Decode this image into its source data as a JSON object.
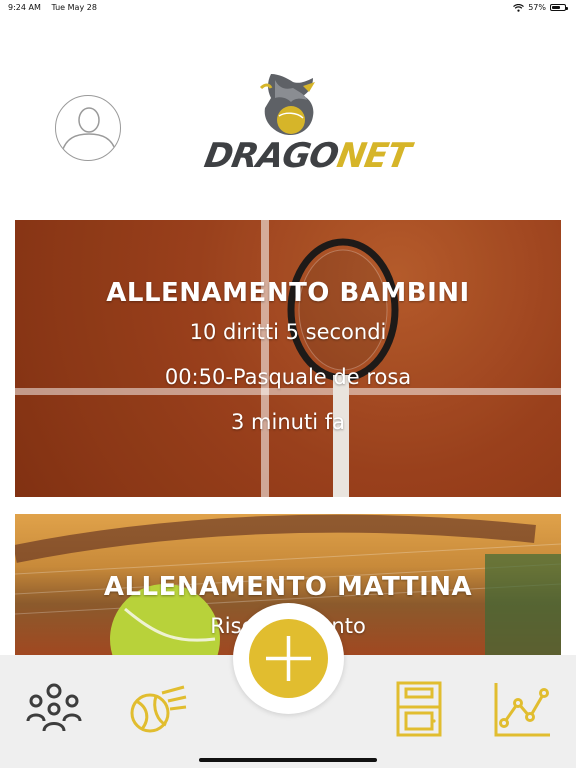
{
  "status_bar": {
    "time": "9:24 AM",
    "date": "Tue May 28",
    "battery": "57%"
  },
  "logo": {
    "text_main": "DRAGO",
    "text_accent": "NET"
  },
  "cards": [
    {
      "title": "ALLENAMENTO BAMBINI",
      "line1": "10 diritti 5 secondi",
      "line2": "00:50-Pasquale de rosa",
      "line3": "3 minuti fa"
    },
    {
      "title": "ALLENAMENTO MATTINA",
      "line1": "Riscaldamento"
    }
  ],
  "tabbar": {
    "icons": [
      "group-icon",
      "tennis-ball-icon",
      "add-icon",
      "locker-icon",
      "stats-chart-icon"
    ]
  },
  "colors": {
    "accent": "#e1bd2f",
    "tabbar_bg": "#efefef",
    "logo_gray": "#3e4043"
  }
}
